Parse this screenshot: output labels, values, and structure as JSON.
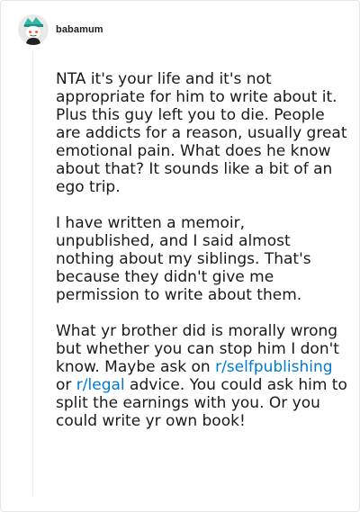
{
  "comment": {
    "username": "babamum",
    "paragraphs": [
      {
        "text": "NTA it's your life and it's not appropriate for him to write about it. Plus this guy left you to die. People are addicts for a reason, usually great emotional pain. What does he know about that? It sounds like a bit of an ego trip."
      },
      {
        "text": "I have written a memoir, unpublished, and I said almost nothing about my siblings. That's because they didn't give me permission to write about them."
      },
      {
        "segments": {
          "before": "What yr brother did is morally wrong but whether you can stop him I don't know. Maybe ask on ",
          "link1": "r/selfpublishing",
          "middle": " or ",
          "link2": "r/legal",
          "after": " advice. You could ask him to split the earnings with you. Or you could write yr own book!"
        }
      }
    ]
  },
  "colors": {
    "link": "#0079d3",
    "text": "#1a1a1b",
    "border": "#e6e6e6"
  },
  "icons": {
    "avatar": "snoo-avatar-icon"
  }
}
